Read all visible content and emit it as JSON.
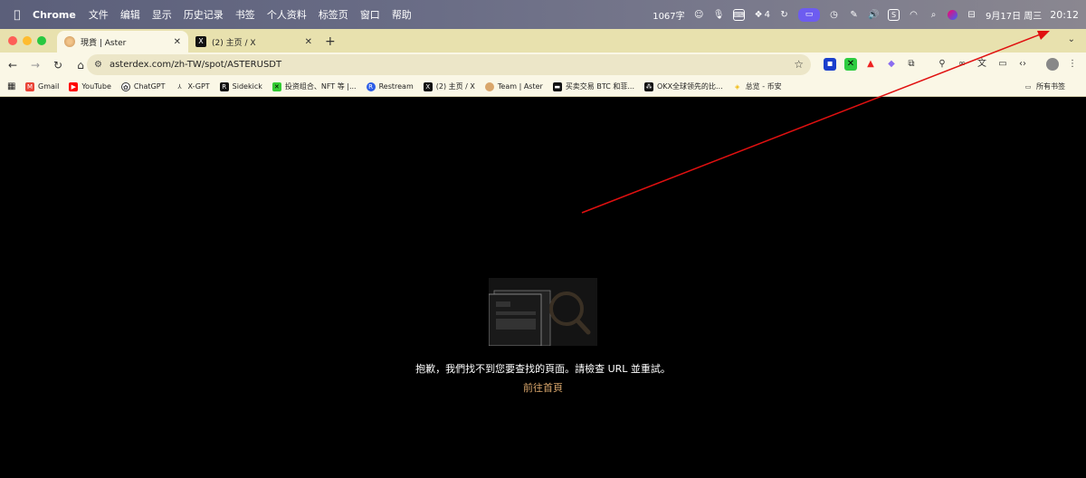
{
  "menubar": {
    "app_name": "Chrome",
    "menus": [
      "文件",
      "编辑",
      "显示",
      "历史记录",
      "书签",
      "个人资料",
      "标签页",
      "窗口",
      "帮助"
    ],
    "word_count": "1067字",
    "badge_count": "4",
    "date": "9月17日 周三",
    "time": "20:12"
  },
  "tabs": [
    {
      "title": "現貨 | Aster",
      "active": true
    },
    {
      "title": "(2) 主页 / X",
      "active": false
    }
  ],
  "toolbar": {
    "url": "asterdex.com/zh-TW/spot/ASTERUSDT"
  },
  "bookmarks": {
    "items": [
      {
        "label": "Gmail",
        "color": "#ea4335"
      },
      {
        "label": "YouTube",
        "color": "#ff0000"
      },
      {
        "label": "ChatGPT",
        "color": "#333333"
      },
      {
        "label": "X-GPT",
        "color": "#444444"
      },
      {
        "label": "Sidekick",
        "color": "#111111"
      },
      {
        "label": "投资组合、NFT 等 |...",
        "color": "#33cc33"
      },
      {
        "label": "Restream",
        "color": "#2b5ce6"
      },
      {
        "label": "(2) 主页 / X",
        "color": "#111111"
      },
      {
        "label": "Team | Aster",
        "color": "#d9a66b"
      },
      {
        "label": "买卖交易 BTC 和菲...",
        "color": "#111111"
      },
      {
        "label": "OKX全球领先的比...",
        "color": "#111111"
      },
      {
        "label": "总览 - 币安",
        "color": "#f0b90b"
      }
    ],
    "all_bookmarks": "所有书签"
  },
  "page": {
    "message": "抱歉，我們找不到您要查找的頁面。請檢查 URL 並重試。",
    "home_link": "前往首頁"
  },
  "colors": {
    "accent_link": "#d9a66b",
    "annotation_arrow": "#e01010"
  }
}
